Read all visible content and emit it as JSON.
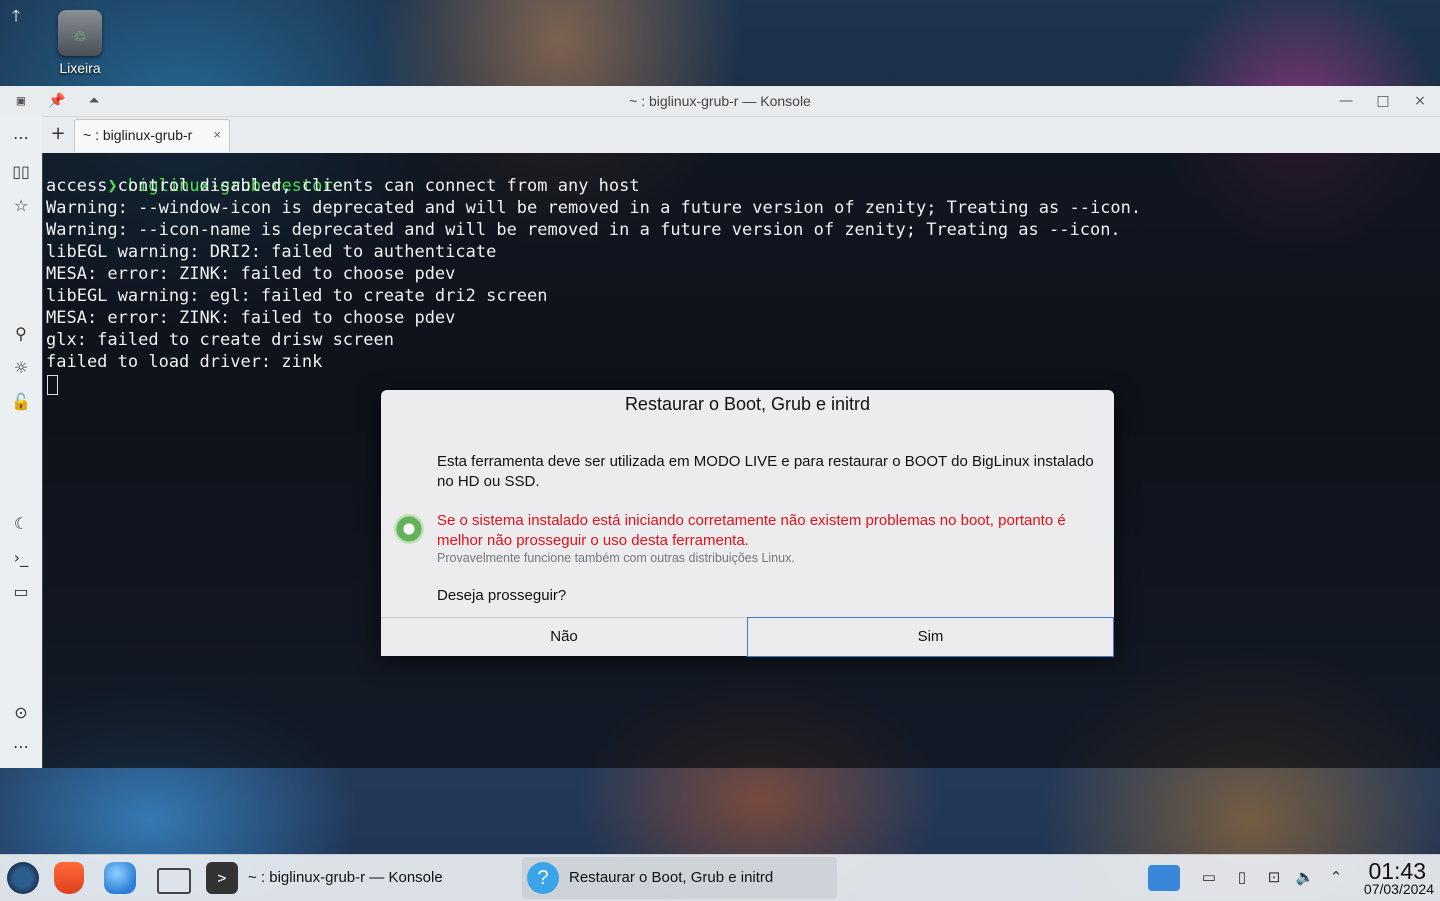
{
  "desktop": {
    "trash_label": "Lixeira"
  },
  "window": {
    "title": "~ : biglinux-grub-r — Konsole",
    "tab_label": "~ : biglinux-grub-r",
    "new_tab_symbol": "+",
    "tab_close_symbol": "×",
    "controls": {
      "minimize": "—",
      "maximize": "□",
      "close": "×"
    }
  },
  "terminal": {
    "prompt_symbol": "❯",
    "command": "biglinux-grub-restore",
    "lines": [
      "access control disabled, clients can connect from any host",
      "Warning: --window-icon is deprecated and will be removed in a future version of zenity; Treating as --icon.",
      "Warning: --icon-name is deprecated and will be removed in a future version of zenity; Treating as --icon.",
      "libEGL warning: DRI2: failed to authenticate",
      "MESA: error: ZINK: failed to choose pdev",
      "libEGL warning: egl: failed to create dri2 screen",
      "MESA: error: ZINK: failed to choose pdev",
      "glx: failed to create drisw screen",
      "failed to load driver: zink"
    ]
  },
  "dialog": {
    "title": "Restaurar o Boot, Grub e initrd",
    "text1": "Esta ferramenta deve ser utilizada em MODO LIVE e para restaurar o BOOT do BigLinux instalado no HD ou SSD.",
    "warning": "Se o sistema instalado está iniciando corretamente não existem problemas no boot, portanto é melhor não prosseguir o uso desta ferramenta.",
    "small_note": "Provavelmente funcione também com outras distribuições Linux.",
    "question": "Deseja prosseguir?",
    "btn_no": "Não",
    "btn_yes": "Sim"
  },
  "taskbar": {
    "task1": "~ : biglinux-grub-r — Konsole",
    "task2": "Restaurar o Boot, Grub e initrd",
    "time": "01:43",
    "date": "07/03/2024"
  },
  "colors": {
    "warning_red": "#e0121b",
    "prompt_green": "#4de04d",
    "accent_blue": "#3b7ed0"
  }
}
